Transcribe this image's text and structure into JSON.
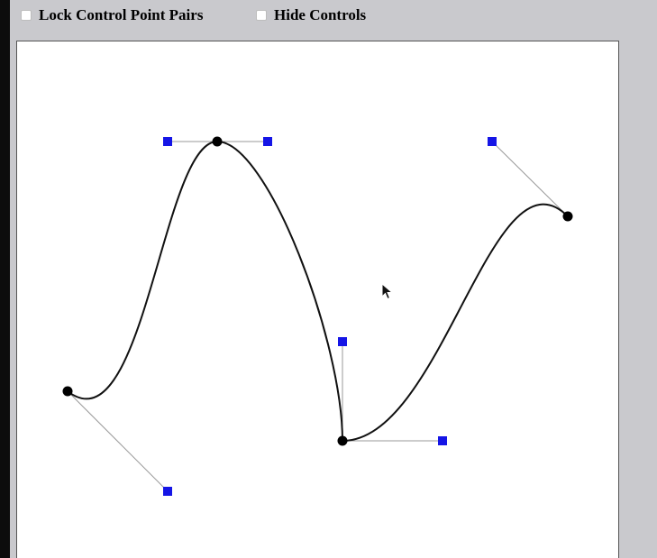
{
  "toolbar": {
    "lock_label": "Lock Control Point Pairs",
    "lock_checked": false,
    "hide_label": "Hide Controls",
    "hide_checked": false
  },
  "colors": {
    "curve": "#111111",
    "anchor": "#000000",
    "handle": "#1515e6",
    "handle_line": "#9a9a9a"
  }
}
